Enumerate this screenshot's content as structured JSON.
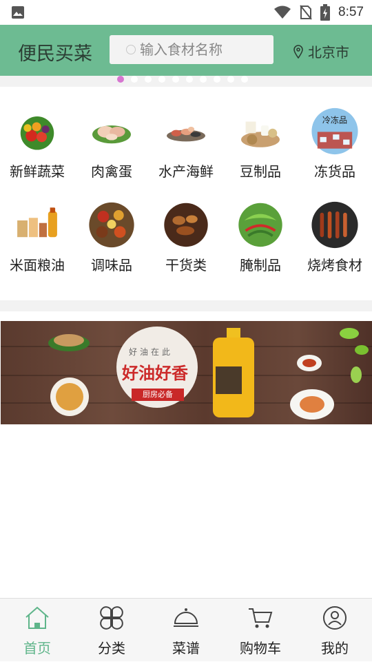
{
  "status_bar": {
    "time": "8:57",
    "icons": [
      "image-icon",
      "wifi-icon",
      "no-sim-icon",
      "battery-icon"
    ]
  },
  "header": {
    "title": "便民买菜",
    "search_placeholder": "输入食材名称",
    "location": "北京市",
    "accent_color": "#6dbb92"
  },
  "carousel": {
    "dot_count": 10,
    "active_index": 0
  },
  "categories": [
    {
      "label": "新鲜蔬菜",
      "icon": "vegetables-icon"
    },
    {
      "label": "肉禽蛋",
      "icon": "poultry-icon"
    },
    {
      "label": "水产海鲜",
      "icon": "seafood-icon"
    },
    {
      "label": "豆制品",
      "icon": "soy-icon"
    },
    {
      "label": "冻货品",
      "icon": "frozen-icon",
      "overlay_text": "冷冻品"
    },
    {
      "label": "米面粮油",
      "icon": "grain-oil-icon"
    },
    {
      "label": "调味品",
      "icon": "spices-icon"
    },
    {
      "label": "干货类",
      "icon": "dried-goods-icon"
    },
    {
      "label": "腌制品",
      "icon": "pickled-icon"
    },
    {
      "label": "烧烤食材",
      "icon": "bbq-icon"
    }
  ],
  "banner": {
    "small_text": "好油在此",
    "big_text": "好油好香",
    "tag_text": "厨房必备"
  },
  "bottom_nav": [
    {
      "label": "首页",
      "icon": "home-icon",
      "active": true
    },
    {
      "label": "分类",
      "icon": "category-icon",
      "active": false
    },
    {
      "label": "菜谱",
      "icon": "cloche-icon",
      "active": false
    },
    {
      "label": "购物车",
      "icon": "cart-icon",
      "active": false
    },
    {
      "label": "我的",
      "icon": "profile-icon",
      "active": false
    }
  ]
}
